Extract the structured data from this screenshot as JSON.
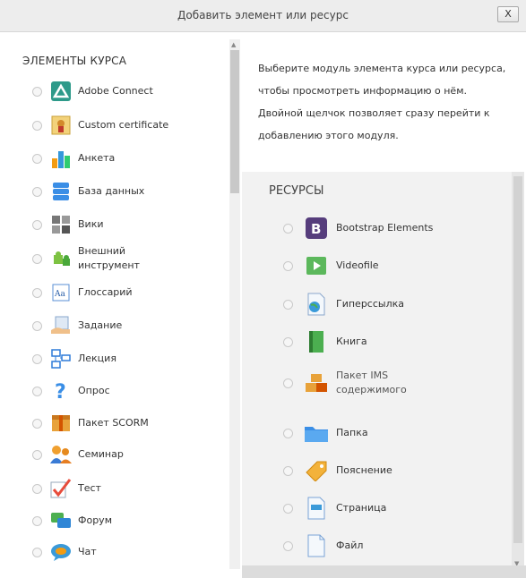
{
  "dialog": {
    "title": "Добавить элемент или ресурс",
    "close_label": "X"
  },
  "activities": {
    "heading": "ЭЛЕМЕНТЫ КУРСА",
    "items": [
      {
        "label": "Adobe Connect",
        "icon": "adobe-connect-icon"
      },
      {
        "label": "Custom certificate",
        "icon": "certificate-icon"
      },
      {
        "label": "Анкета",
        "icon": "chart-icon"
      },
      {
        "label": "База данных",
        "icon": "database-icon"
      },
      {
        "label": "Вики",
        "icon": "wiki-icon"
      },
      {
        "label": "Внешний",
        "label2": "инструмент",
        "icon": "puzzle-icon"
      },
      {
        "label": "Глоссарий",
        "icon": "glossary-icon"
      },
      {
        "label": "Задание",
        "icon": "assignment-icon"
      },
      {
        "label": "Лекция",
        "icon": "lesson-icon"
      },
      {
        "label": "Опрос",
        "icon": "question-icon"
      },
      {
        "label": "Пакет SCORM",
        "icon": "scorm-package-icon"
      },
      {
        "label": "Семинар",
        "icon": "workshop-icon"
      },
      {
        "label": "Тест",
        "icon": "quiz-icon"
      },
      {
        "label": "Форум",
        "icon": "forum-icon"
      },
      {
        "label": "Чат",
        "icon": "chat-icon"
      }
    ]
  },
  "info": {
    "text": "Выберите модуль элемента курса или ресурса, чтобы просмотреть информацию о нём. Двойной щелчок позволяет сразу перейти к добавлению этого модуля."
  },
  "resources": {
    "heading": "РЕСУРСЫ",
    "items": [
      {
        "label": "Bootstrap Elements",
        "icon": "bootstrap-icon"
      },
      {
        "label": "Videofile",
        "icon": "video-icon"
      },
      {
        "label": "Гиперссылка",
        "icon": "url-icon"
      },
      {
        "label": "Книга",
        "icon": "book-icon"
      },
      {
        "label": "Пакет IMS",
        "label2": "содержимого",
        "icon": "ims-package-icon"
      },
      {
        "label": "Папка",
        "icon": "folder-icon"
      },
      {
        "label": "Пояснение",
        "icon": "label-tag-icon"
      },
      {
        "label": "Страница",
        "icon": "page-icon"
      },
      {
        "label": "Файл",
        "icon": "file-icon"
      }
    ]
  }
}
